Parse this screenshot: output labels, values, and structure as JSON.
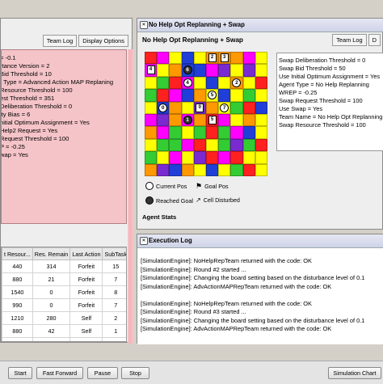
{
  "left_panel": {
    "tabs": [
      "Team Log",
      "Display Options"
    ],
    "info_lines": [
      "= -0.1",
      "rtance Version = 2",
      "Bid Threshold = 10",
      "t Type = Advanced Action MAP Replaning",
      "Resource Threshold = 100",
      "est Threshold = 351",
      "Deliberation Threshold = 0",
      "ity Bias = 6",
      "nitial Optimum Assignment = Yes",
      "Help2 Request = Yes",
      "Request Threshold = 100",
      "P = -0.25",
      "wap = Yes"
    ],
    "table": {
      "headers": [
        "t Resour...",
        "Res. Remain",
        "Last Action",
        "SubTask"
      ],
      "rows": [
        [
          "440",
          "314",
          "Forfeit",
          "15"
        ],
        [
          "880",
          "21",
          "Forfeit",
          "7"
        ],
        [
          "1540",
          "0",
          "Forfeit",
          "8"
        ],
        [
          "990",
          "0",
          "Forfeit",
          "7"
        ],
        [
          "1210",
          "280",
          "Self",
          "2"
        ],
        [
          "880",
          "42",
          "Self",
          "1"
        ],
        [
          "880",
          "0",
          "Forfeit",
          "2"
        ]
      ]
    }
  },
  "right_panel": {
    "title": "No Help Opt Replanning + Swap",
    "heading": "No Help Opt Replanning + Swap",
    "tabs": [
      "Team Log",
      "D"
    ],
    "info_lines": [
      "Swap Deliberation Threshold = 0",
      "Swap Bid Threshold = 50",
      "Use Initial Optimum Assignment = Yes",
      "Agent Type = No Help Replanning",
      "WREP = -0.25",
      "Swap Request Threshold = 100",
      "Use Swap = Yes",
      "Team Name = No Help Opt Replanning",
      "Swap Resource Threshold = 100"
    ],
    "legend": {
      "current_pos": "Current Pos",
      "goal_pos": "Goal Pos",
      "reached_goal": "Reached Goal",
      "cell_disturbed": "Cell Disturbed"
    },
    "agent_stats": "Agent Stats",
    "board_colors": {
      "Y": "#ffff00",
      "M": "#ff00ff",
      "G": "#33cc33",
      "B": "#1f3fd8",
      "R": "#ff2020",
      "O": "#ff9900",
      "P": "#7a2ad0",
      "L": "#a8a8ff",
      "W": "#f6f6f6"
    },
    "board": [
      "RMYBYOOOMY",
      "MYOBBMPYPY",
      "YGRMYBYOYR",
      "GRMBOYBYGY",
      "YBOYPOYGRB",
      "MPOMORMYOY",
      "OMGYGRGMBY",
      "YGGMRYGPGR",
      "GYMYPRMRYY",
      "OPBOYBYGRY"
    ],
    "current_markers": [
      {
        "label": "6",
        "row": 1,
        "col": 3,
        "style": "dark"
      },
      {
        "label": "4",
        "row": 2,
        "col": 3,
        "style": "white"
      },
      {
        "label": "2",
        "row": 2,
        "col": 7,
        "style": "white"
      },
      {
        "label": "5",
        "row": 3,
        "col": 5,
        "style": "white"
      },
      {
        "label": "0",
        "row": 4,
        "col": 1,
        "style": "white"
      },
      {
        "label": "7",
        "row": 4,
        "col": 6,
        "style": "white"
      },
      {
        "label": "1",
        "row": 5,
        "col": 3,
        "style": "dark"
      }
    ],
    "goal_markers": [
      {
        "label": "2",
        "row": 0,
        "col": 5
      },
      {
        "label": "3",
        "row": 0,
        "col": 6
      },
      {
        "label": "4",
        "row": 1,
        "col": 0
      },
      {
        "label": "0",
        "row": 4,
        "col": 4
      },
      {
        "label": "5",
        "row": 5,
        "col": 5
      }
    ]
  },
  "log_panel": {
    "title": "Execution Log",
    "lines": [
      "[SimulationEngine]: NoHelpRepTeam returned with the code: OK",
      "[SimulationEngine]: Round #2 started ...",
      "[SimulationEngine]: Changing the board setting based on the disturbance level of 0.1",
      "[SimulationEngine]: AdvActionMAPRepTeam returned with the code: OK",
      "",
      "[SimulationEngine]: NoHelpRepTeam returned with the code: OK",
      "[SimulationEngine]: Round #3 started ...",
      "[SimulationEngine]: Changing the board setting based on the disturbance level of 0.1",
      "[SimulationEngine]: AdvActionMAPRepTeam returned with the code: OK"
    ]
  },
  "toolbar": {
    "start": "Start",
    "fast_forward": "Fast Forward",
    "pause": "Pause",
    "stop": "Stop",
    "simulation_chart": "Simulation Chart"
  }
}
